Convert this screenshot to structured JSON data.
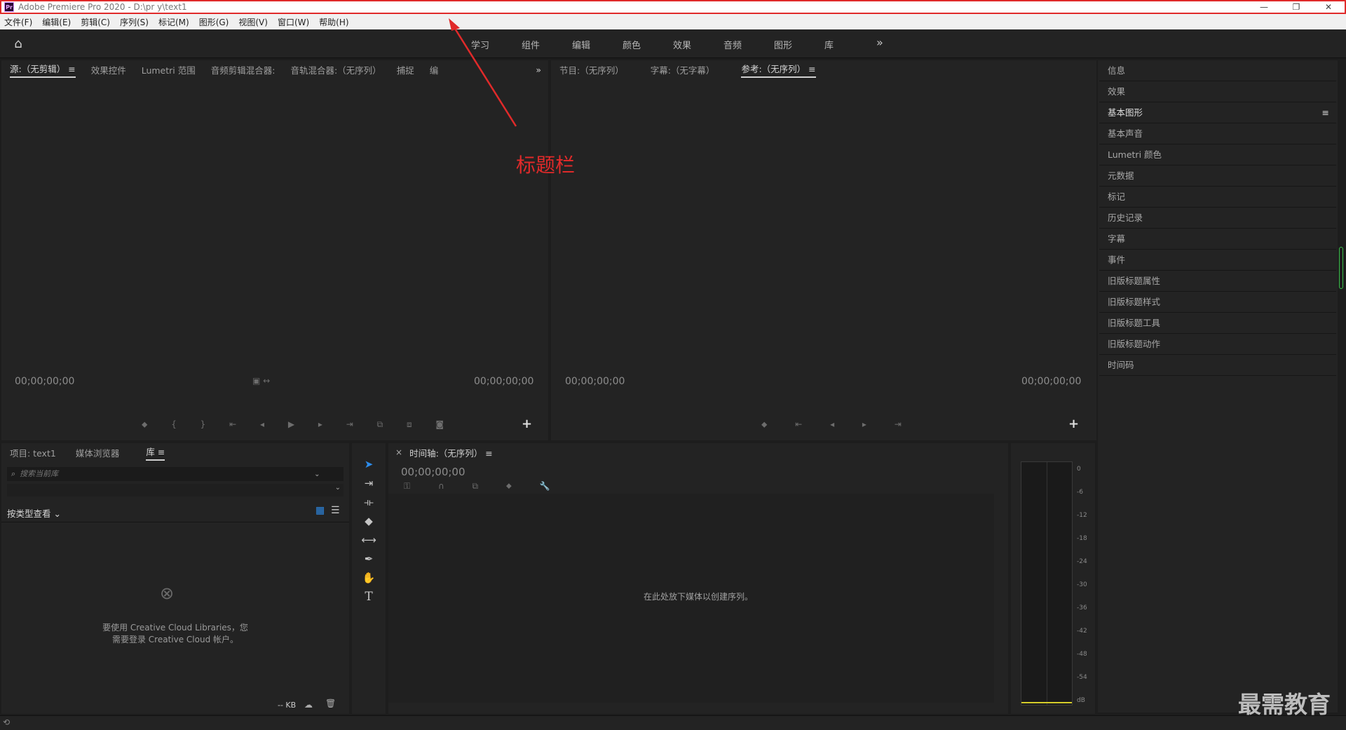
{
  "titlebar": {
    "logo": "Pr",
    "title": "Adobe Premiere Pro 2020 - D:\\pr y\\text1",
    "minimize": "—",
    "restore": "❐",
    "close": "✕"
  },
  "menu": [
    "文件(F)",
    "编辑(E)",
    "剪辑(C)",
    "序列(S)",
    "标记(M)",
    "图形(G)",
    "视图(V)",
    "窗口(W)",
    "帮助(H)"
  ],
  "workspaces": [
    "学习",
    "组件",
    "编辑",
    "颜色",
    "效果",
    "音频",
    "图形",
    "库"
  ],
  "source_panel": {
    "tabs": [
      "源:（无剪辑）",
      "效果控件",
      "Lumetri 范围",
      "音频剪辑混合器:",
      "音轨混合器:（无序列）",
      "捕捉",
      "编"
    ],
    "timecode_left": "00;00;00;00",
    "timecode_right": "00;00;00;00"
  },
  "program_panel": {
    "tabs": [
      "节目:（无序列）",
      "字幕:（无字幕）",
      "参考:（无序列）"
    ],
    "timecode_left": "00;00;00;00",
    "timecode_right": "00;00;00;00"
  },
  "right_stack": [
    "信息",
    "效果",
    "基本图形",
    "基本声音",
    "Lumetri 颜色",
    "元数据",
    "标记",
    "历史记录",
    "字幕",
    "事件",
    "旧版标题属性",
    "旧版标题样式",
    "旧版标题工具",
    "旧版标题动作",
    "时间码"
  ],
  "project_panel": {
    "tabs": [
      "项目: text1",
      "媒体浏览器",
      "库"
    ],
    "search_placeholder": "搜索当前库",
    "view_label": "按类型查看",
    "message_line1": "要使用 Creative Cloud Libraries，您",
    "message_line2": "需要登录 Creative Cloud 帐户。",
    "size": "-- KB"
  },
  "timeline": {
    "close": "×",
    "title": "时间轴:（无序列）",
    "timecode": "00;00;00;00",
    "drop_message": "在此处放下媒体以创建序列。"
  },
  "meter_ticks": [
    "0",
    "-6",
    "-12",
    "-18",
    "-24",
    "-30",
    "-36",
    "-42",
    "-48",
    "-54",
    "dB"
  ],
  "annotation": "标题栏",
  "watermark": "最需教育",
  "colors": {
    "accent": "#2d8ceb",
    "annotation": "#e02a2a"
  }
}
